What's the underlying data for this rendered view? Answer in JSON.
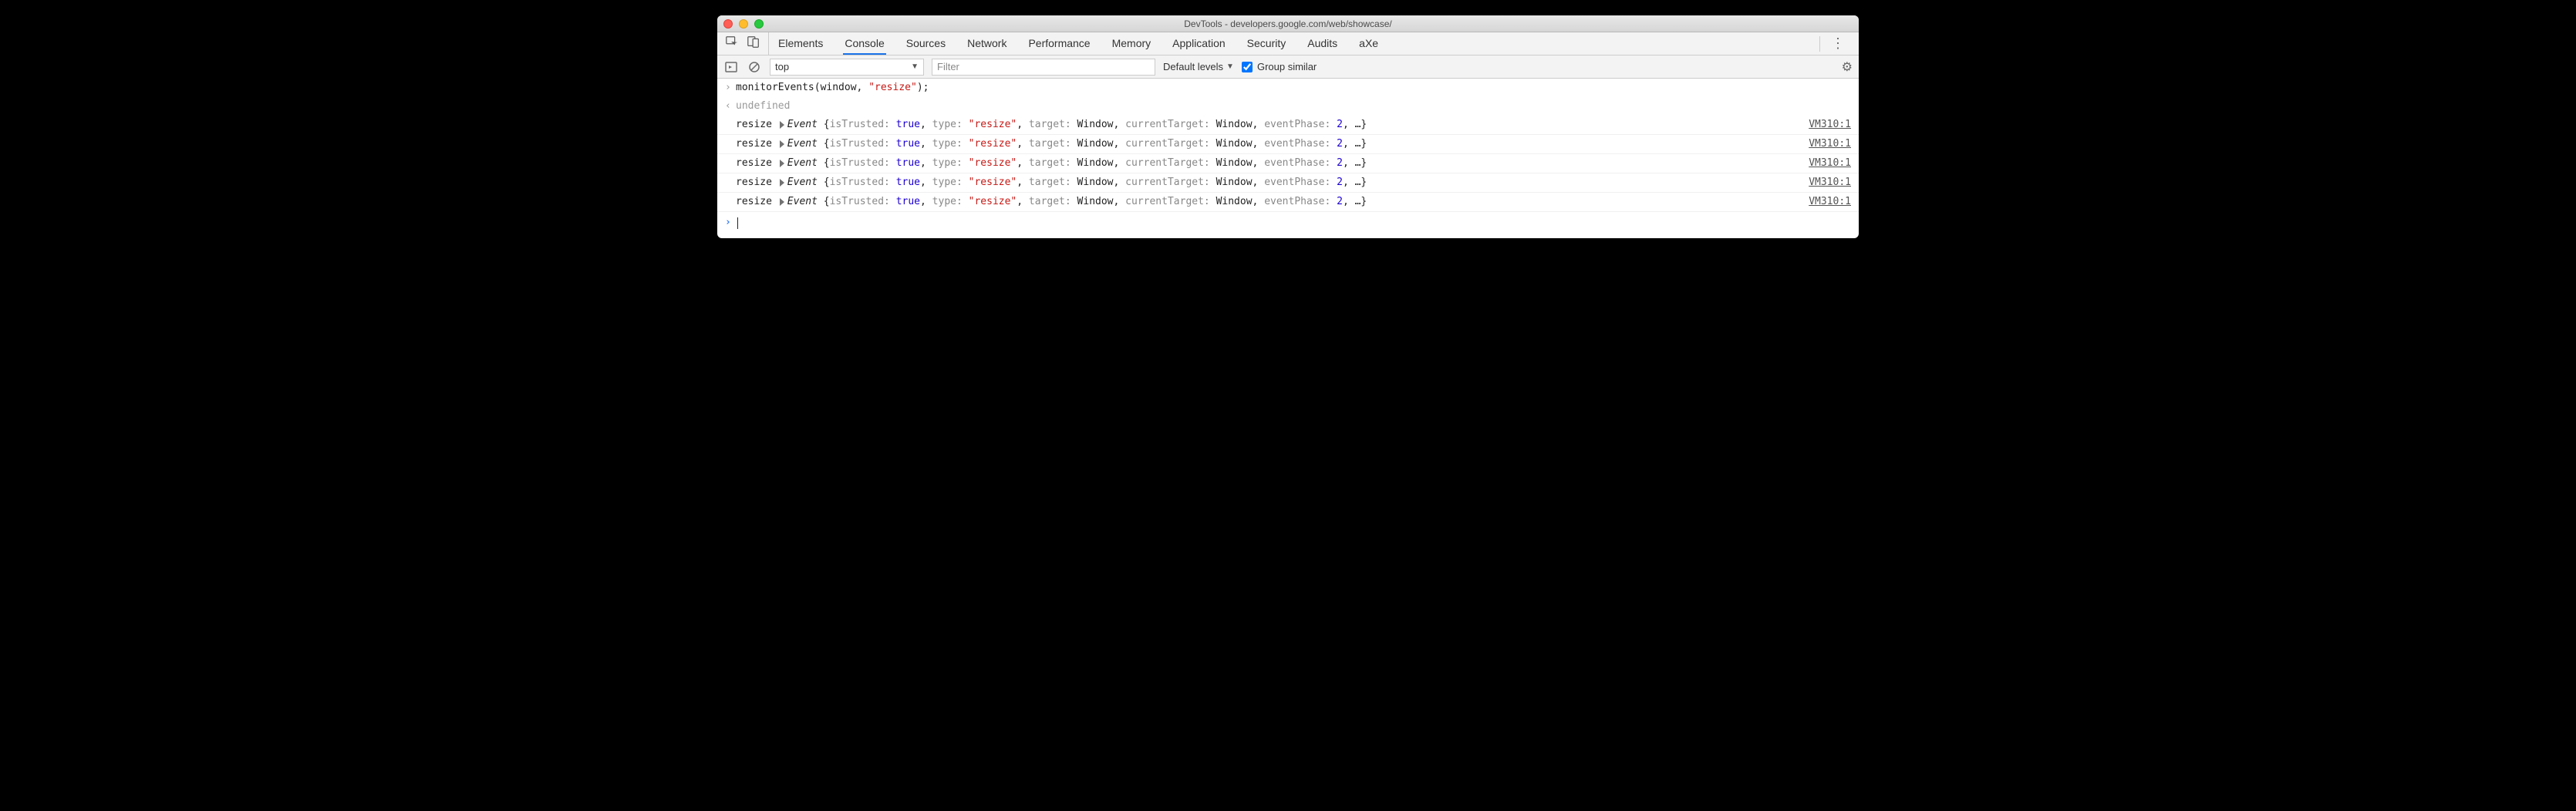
{
  "window_title": "DevTools - developers.google.com/web/showcase/",
  "tabs": [
    "Elements",
    "Console",
    "Sources",
    "Network",
    "Performance",
    "Memory",
    "Application",
    "Security",
    "Audits",
    "aXe"
  ],
  "active_tab": "Console",
  "console_bar": {
    "context": "top",
    "filter_placeholder": "Filter",
    "levels_label": "Default levels",
    "group_label": "Group similar",
    "group_checked": true
  },
  "input_line": {
    "fn": "monitorEvents",
    "arg1": "window",
    "arg2": "\"resize\""
  },
  "output_value": "undefined",
  "log_source": "VM310:1",
  "event_row": {
    "name": "resize",
    "obj": "Event",
    "kv": [
      {
        "k": "isTrusted",
        "v": "true",
        "cls": "bool"
      },
      {
        "k": "type",
        "v": "\"resize\"",
        "cls": "str"
      },
      {
        "k": "target",
        "v": "Window",
        "cls": "objv"
      },
      {
        "k": "currentTarget",
        "v": "Window",
        "cls": "objv"
      },
      {
        "k": "eventPhase",
        "v": "2",
        "cls": "num"
      }
    ]
  },
  "event_count": 5
}
